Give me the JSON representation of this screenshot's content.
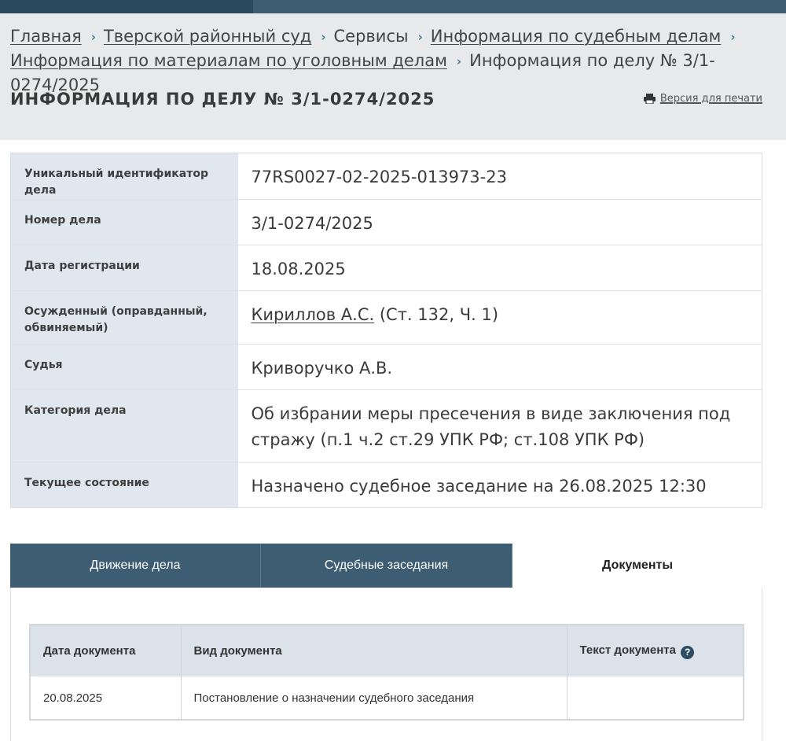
{
  "breadcrumb": {
    "items": [
      {
        "label": "Главная",
        "link": true
      },
      {
        "label": "Тверской районный суд",
        "link": true
      },
      {
        "label": "Сервисы",
        "link": false
      },
      {
        "label": "Информация по судебным делам",
        "link": true
      },
      {
        "label": "Информация по материалам по уголовным делам",
        "link": true
      },
      {
        "label": "Информация по делу № 3/1-0274/2025",
        "link": false
      }
    ]
  },
  "page": {
    "title": "ИНФОРМАЦИЯ ПО ДЕЛУ № 3/1-0274/2025",
    "print_label": "Версия для печати"
  },
  "case_info": [
    {
      "label": "Уникальный идентификатор дела",
      "value": "77RS0027-02-2025-013973-23"
    },
    {
      "label": "Номер дела",
      "value": "3/1-0274/2025"
    },
    {
      "label": "Дата регистрации",
      "value": "18.08.2025"
    },
    {
      "label": "Осужденный (оправданный, обвиняемый)",
      "value_link": "Кириллов А.С.",
      "value_rest": " (Ст. 132, Ч. 1)"
    },
    {
      "label": "Судья",
      "value": "Криворучко А.В."
    },
    {
      "label": "Категория дела",
      "value": "Об избрании меры пресечения в виде заключения под стражу (п.1 ч.2 ст.29 УПК РФ; ст.108 УПК РФ)"
    },
    {
      "label": "Текущее состояние",
      "value": "Назначено судебное заседание на 26.08.2025 12:30"
    }
  ],
  "tabs": [
    {
      "label": "Движение дела",
      "active": false
    },
    {
      "label": "Судебные заседания",
      "active": false
    },
    {
      "label": "Документы",
      "active": true
    }
  ],
  "documents": {
    "columns": [
      "Дата документа",
      "Вид документа",
      "Текст документа"
    ],
    "help_glyph": "?",
    "rows": [
      {
        "date": "20.08.2025",
        "type": "Постановление о назначении судебного заседания",
        "text": ""
      }
    ]
  },
  "colors": {
    "brand_dark": "#3d5d73",
    "label_bg": "#e1e7ef",
    "header_bg": "#e8e9ea"
  }
}
